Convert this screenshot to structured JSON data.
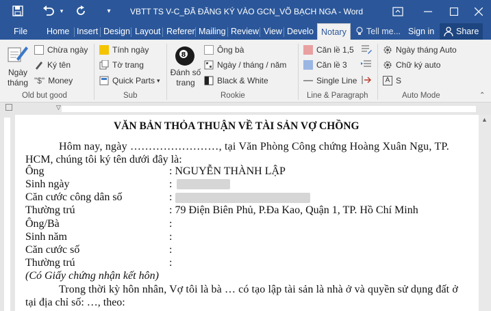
{
  "window": {
    "title": "VBTT TS V-C_ĐÃ ĐĂNG KÝ VÀO GCN_VÕ BẠCH NGA - Word",
    "accent": "#2b579a"
  },
  "tabs": [
    {
      "label": "File"
    },
    {
      "label": "Home"
    },
    {
      "label": "Insert"
    },
    {
      "label": "Design"
    },
    {
      "label": "Layout"
    },
    {
      "label": "Referer"
    },
    {
      "label": "Mailing"
    },
    {
      "label": "Review"
    },
    {
      "label": "View"
    },
    {
      "label": "Develo"
    },
    {
      "label": "Notary"
    }
  ],
  "tell_me": "Tell me...",
  "sign_in": "Sign in",
  "share": "Share",
  "ribbon": {
    "oldbutgood": {
      "ngay_thang": "Ngày tháng",
      "chua_ngay": "Chừa ngày",
      "ky_ten": "Ký tên",
      "money": "Money",
      "label": "Old but good"
    },
    "sub": {
      "tinh_ngay": "Tính ngày",
      "to_trang": "Tờ trang",
      "quick_parts": "Quick Parts",
      "label": "Sub"
    },
    "rookie": {
      "danh_so_trang": "Đánh số trang",
      "ong_ba": "Ông bà",
      "ngay_thang_nam": "Ngày / tháng / năm",
      "black_white": "Black & White",
      "label": "Rookie"
    },
    "line_paragraph": {
      "can_le_15": "Căn lề 1,5",
      "can_le_3": "Căn lề 3",
      "single_line": "Single Line",
      "label": "Line & Paragraph"
    },
    "auto_mode": {
      "ngay_thang_auto": "Ngày tháng Auto",
      "chu_ky_auto": "Chữ ký auto",
      "s": "S",
      "label": "Auto Mode"
    }
  },
  "document": {
    "heading": "VĂN BẢN THỎA THUẬN VỀ TÀI SẢN VỢ CHỒNG",
    "intro_line1": "Hôm nay, ngày ……………………, tại Văn Phòng Công chứng Hoàng Xuân Ngu, TP.",
    "intro_line2": "HCM, chúng tôi ký tên dưới đây là:",
    "fields": [
      {
        "label": "Ông",
        "value": ": NGUYỄN THÀNH LẬP"
      },
      {
        "label": "Sinh ngày",
        "value": ":"
      },
      {
        "label": "Căn cước công dân số",
        "value": ":"
      },
      {
        "label": "Thường trú",
        "value": ": 79 Điện Biên Phủ, P.Đa Kao, Quận 1, TP. Hồ Chí Minh"
      },
      {
        "label": "Ông/Bà",
        "value": ":"
      },
      {
        "label": "Sinh năm",
        "value": ":"
      },
      {
        "label": "Căn cước số",
        "value": ":"
      },
      {
        "label": "Thường trú",
        "value": ":"
      }
    ],
    "note": "(Có Giấy chứng nhận kết hôn)",
    "para_line1": "Trong thời kỳ hôn nhân, Vợ tôi là bà … có tạo lập tài sản là nhà ở và quyền sử dụng đất ở",
    "para_line2": "tại địa chỉ số: …, theo:"
  }
}
